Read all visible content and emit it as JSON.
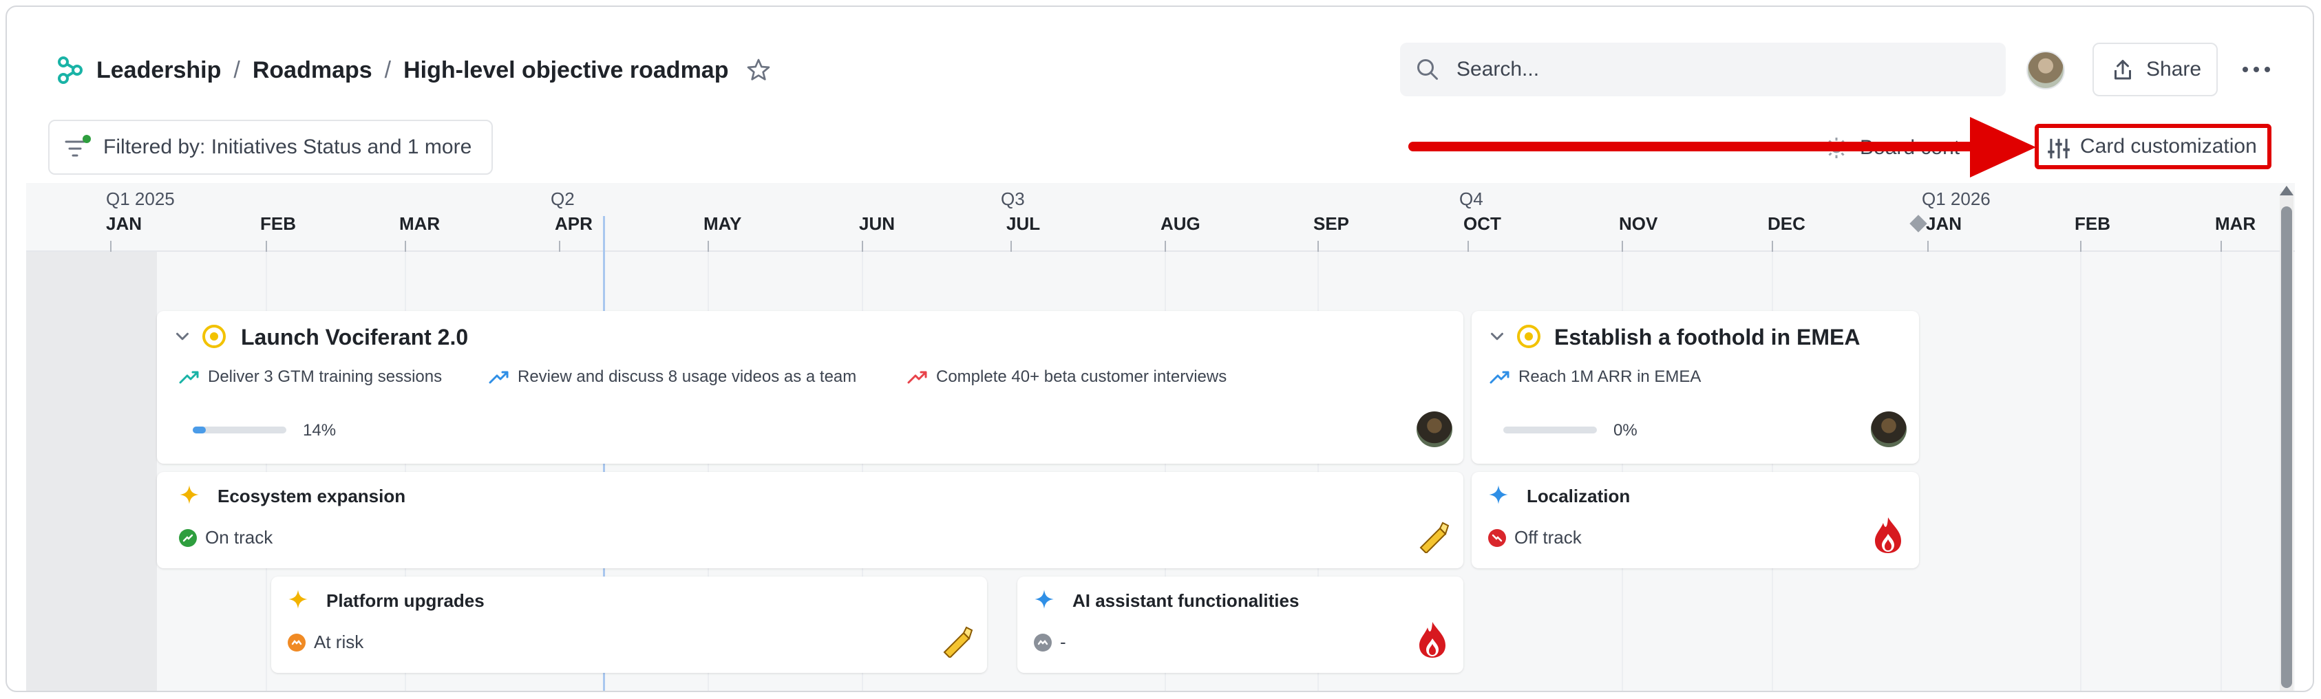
{
  "breadcrumb": {
    "items": [
      "Leadership",
      "Roadmaps",
      "High-level objective roadmap"
    ],
    "separator": "/"
  },
  "search": {
    "placeholder": "Search..."
  },
  "header": {
    "share_label": "Share"
  },
  "toolbar": {
    "filter_label": "Filtered by: Initiatives Status and 1 more",
    "board_label": "Board cont",
    "card_customization_label": "Card customization"
  },
  "timeline": {
    "quarters": [
      "Q1 2025",
      "Q2",
      "Q3",
      "Q4",
      "Q1 2026"
    ],
    "months": [
      "JAN",
      "FEB",
      "MAR",
      "APR",
      "MAY",
      "JUN",
      "JUL",
      "AUG",
      "SEP",
      "OCT",
      "NOV",
      "DEC",
      "JAN",
      "FEB",
      "MAR"
    ]
  },
  "objectives": [
    {
      "title": "Launch Vociferant 2.0",
      "key_results": [
        {
          "label": "Deliver 3 GTM training sessions",
          "trend_color": "#19b3a6"
        },
        {
          "label": "Review and discuss 8 usage videos as a team",
          "trend_color": "#2f8fe6"
        },
        {
          "label": "Complete 40+ beta customer interviews",
          "trend_color": "#e8424a"
        }
      ],
      "progress": 0.14,
      "progress_label": "14%"
    },
    {
      "title": "Establish a foothold in EMEA",
      "key_results": [
        {
          "label": "Reach 1M ARR in EMEA",
          "trend_color": "#2f8fe6"
        }
      ],
      "progress": 0,
      "progress_label": "0%"
    }
  ],
  "initiatives": [
    {
      "title": "Ecosystem expansion",
      "status": "On track",
      "status_color": "#2e9e3e",
      "sparkle_color": "#f2b300",
      "icon": "flashlight-icon"
    },
    {
      "title": "Localization",
      "status": "Off track",
      "status_color": "#d9262c",
      "sparkle_color": "#2f8fe6",
      "icon": "fire-icon"
    },
    {
      "title": "Platform upgrades",
      "status": "At risk",
      "status_color": "#f08a24",
      "sparkle_color": "#f2b300",
      "icon": "flashlight-icon"
    },
    {
      "title": "AI assistant functionalities",
      "status": "-",
      "status_color": "#8a9099",
      "sparkle_color": "#2f8fe6",
      "icon": "fire-icon"
    }
  ]
}
